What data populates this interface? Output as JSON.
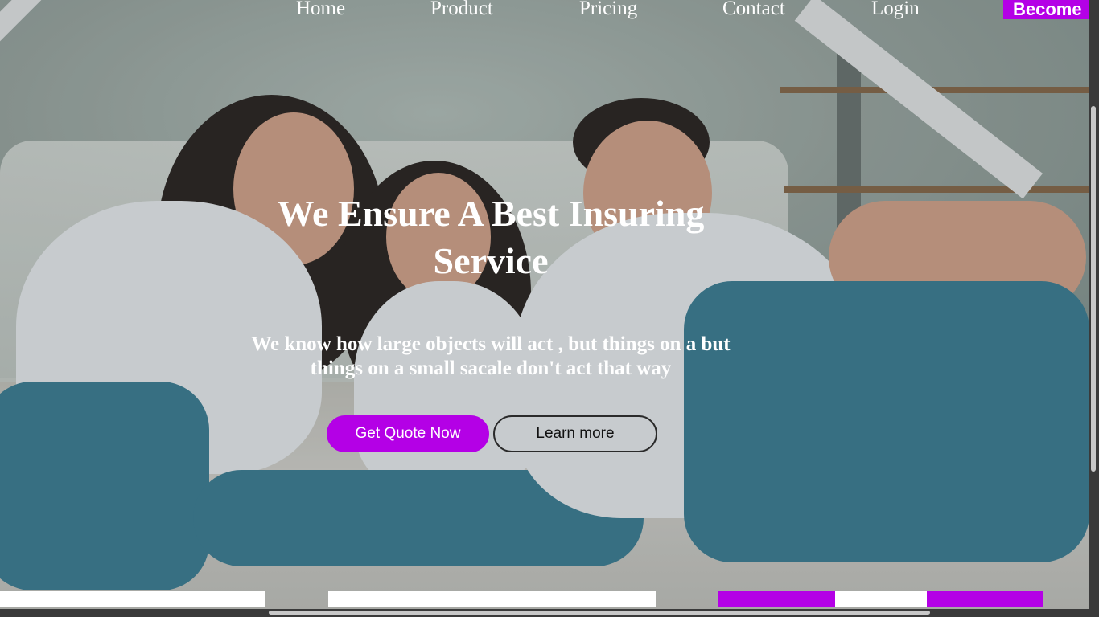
{
  "nav": {
    "items": [
      "Home",
      "Product",
      "Pricing",
      "Contact",
      "Login"
    ],
    "cta": "Become"
  },
  "hero": {
    "title": "We Ensure A Best Insuring Service",
    "subtitle": "We know how large objects will act , but things on a but things on a small sacale don't act that way",
    "primary_button": "Get Quote Now",
    "secondary_button": "Learn more"
  },
  "colors": {
    "accent": "#b400e6",
    "text": "#ffffff",
    "scrollbar_track": "#3a3a3a",
    "scrollbar_thumb": "#c8c8c8"
  }
}
